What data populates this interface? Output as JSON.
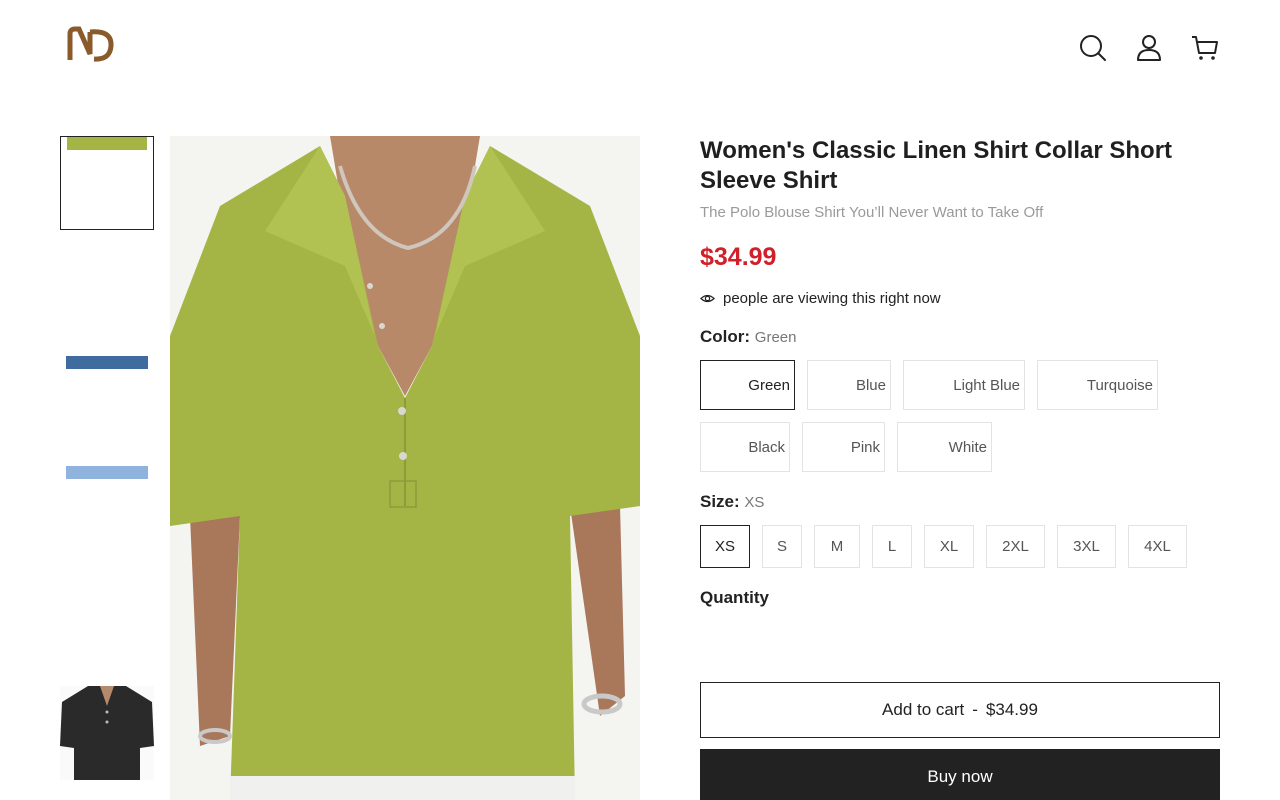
{
  "header": {
    "logo_icon": "nd-monogram-logo",
    "icons": [
      "search-icon",
      "account-icon",
      "cart-icon"
    ]
  },
  "gallery": {
    "thumbnails": [
      "green-shirt",
      "blue-shirt",
      "light-blue-shirt",
      "black-shirt"
    ],
    "main_image": "model-wearing-green-linen-shirt"
  },
  "product": {
    "title": "Women's Classic Linen Shirt Collar Short Sleeve Shirt",
    "subtitle": "The Polo Blouse Shirt You’ll Never Want to Take Off",
    "price": "$34.99",
    "viewing_text": "people are viewing this right now"
  },
  "color": {
    "label": "Color:",
    "selected": "Green",
    "options": [
      "Green",
      "Blue",
      "Light Blue",
      "Turquoise",
      "Black",
      "Pink",
      "White"
    ]
  },
  "size": {
    "label": "Size:",
    "selected": "XS",
    "options": [
      "XS",
      "S",
      "M",
      "L",
      "XL",
      "2XL",
      "3XL",
      "4XL"
    ]
  },
  "quantity": {
    "label": "Quantity"
  },
  "actions": {
    "add_to_cart_label": "Add to cart",
    "add_to_cart_separator": "-",
    "add_to_cart_price": "$34.99",
    "buy_now_label": "Buy now"
  },
  "colors": {
    "price": "#d0202a",
    "logo": "#8a5a2b",
    "shirt_green": "#a4b545",
    "dark_button": "#222222"
  }
}
